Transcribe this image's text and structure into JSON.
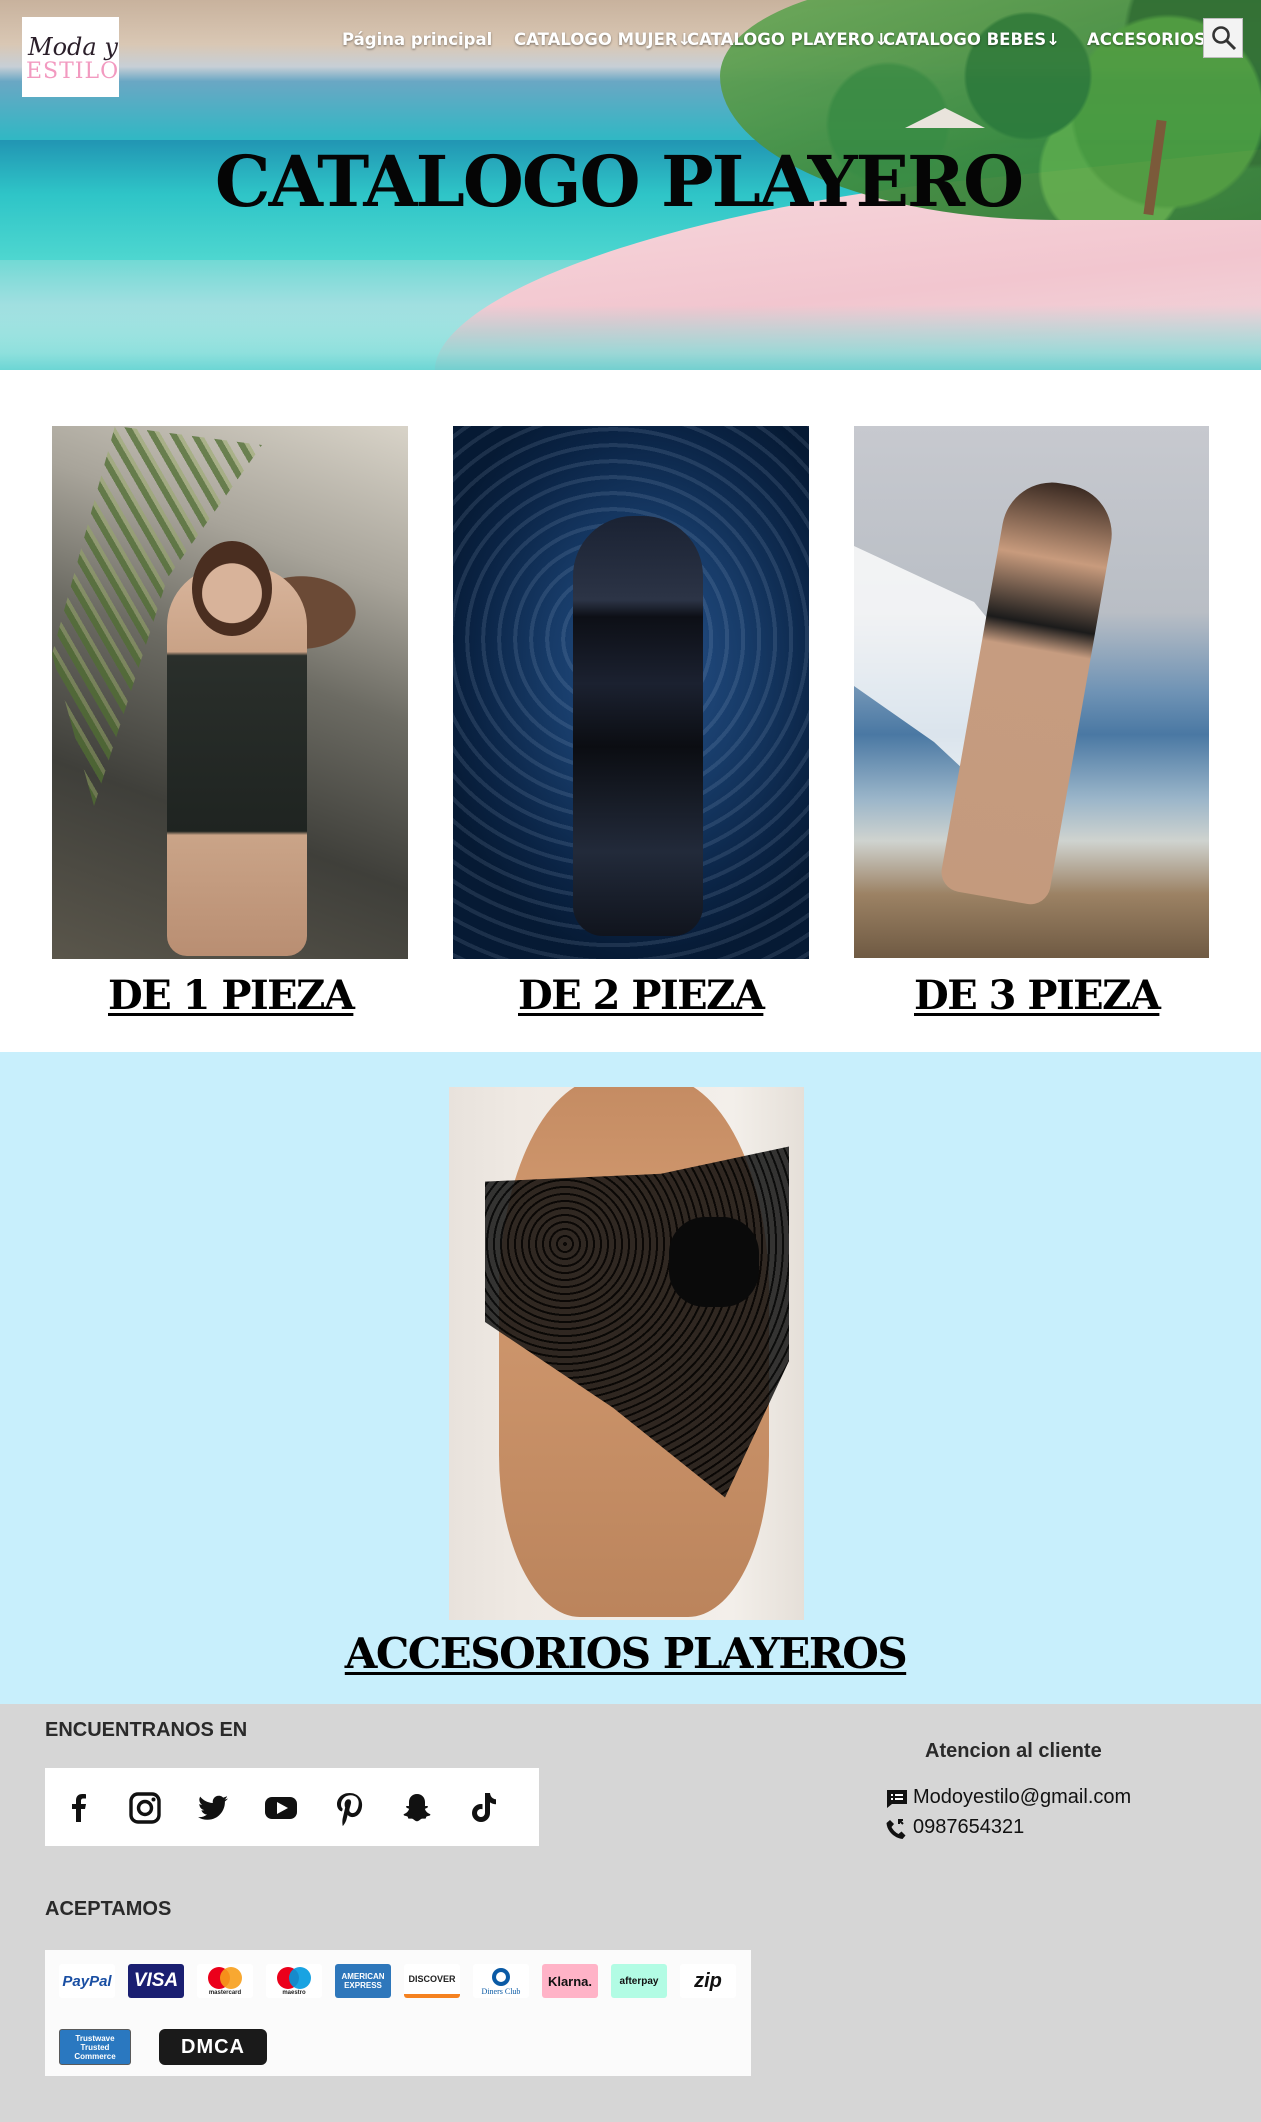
{
  "header": {
    "logo": {
      "line1": "Moda y",
      "line2": "ESTILO"
    },
    "nav": [
      {
        "label": "Página principal"
      },
      {
        "label": "CATALOGO MUJER↓"
      },
      {
        "label": "CATALOGO PLAYERO↓"
      },
      {
        "label": "CATALOGO BEBES↓"
      },
      {
        "label": "ACCESORIOS↓"
      }
    ],
    "search_icon": "search-icon",
    "hero_title": "CATALOGO PLAYERO"
  },
  "products": [
    {
      "label": "DE 1 PIEZA"
    },
    {
      "label": "DE 2 PIEZA"
    },
    {
      "label": "DE 3 PIEZA"
    }
  ],
  "accessories": {
    "label": "ACCESORIOS PLAYEROS"
  },
  "footer": {
    "find_us": "ENCUENTRANOS EN",
    "social_icons": [
      "facebook-icon",
      "instagram-icon",
      "twitter-icon",
      "youtube-icon",
      "pinterest-icon",
      "snapchat-icon",
      "tiktok-icon"
    ],
    "accept": "ACEPTAMOS",
    "payments": [
      {
        "label": "PayPal",
        "color": "#1a4fa3",
        "bg": "#ffffff"
      },
      {
        "label": "VISA",
        "color": "#ffffff",
        "bg": "#1a1f71"
      },
      {
        "label": "mastercard",
        "color": "#222222",
        "bg": "#ffffff"
      },
      {
        "label": "maestro",
        "color": "#222222",
        "bg": "#ffffff"
      },
      {
        "label": "AMERICAN EXPRESS",
        "color": "#ffffff",
        "bg": "#2e77bb"
      },
      {
        "label": "DISCOVER",
        "color": "#222222",
        "bg": "#ffffff"
      },
      {
        "label": "Diners Club",
        "color": "#0a5aa5",
        "bg": "#ffffff"
      },
      {
        "label": "Klarna.",
        "color": "#111111",
        "bg": "#ffb3c7"
      },
      {
        "label": "afterpay",
        "color": "#111111",
        "bg": "#b2fce4"
      },
      {
        "label": "zip",
        "color": "#111111",
        "bg": "#ffffff"
      }
    ],
    "trust": [
      {
        "label": "Trustwave Trusted Commerce",
        "color": "#ffffff",
        "bg": "#2a78c0"
      },
      {
        "label": "DMCA",
        "color": "#ffffff",
        "bg": "#1a1a1a"
      }
    ],
    "service_title": "Atencion al cliente",
    "email": "Modoyestilo@gmail.com",
    "phone": "0987654321"
  }
}
